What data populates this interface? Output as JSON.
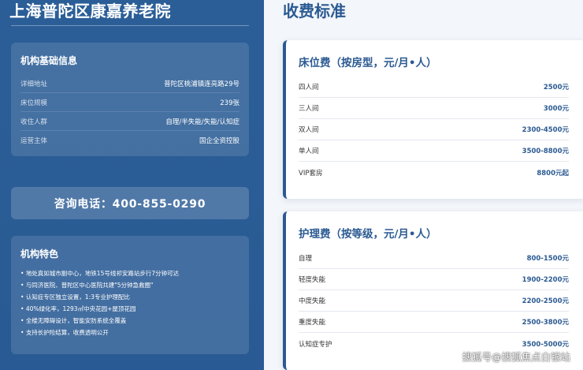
{
  "left": {
    "site_title": "上海普陀区康嘉养老院",
    "info_card": {
      "title": "机构基础信息",
      "rows": [
        {
          "label": "详细地址",
          "value": "普陀区桃浦镇连亮路29号"
        },
        {
          "label": "床位规模",
          "value": "239张"
        },
        {
          "label": "收住人群",
          "value": "自理/半失能/失能/认知症"
        },
        {
          "label": "运营主体",
          "value": "国企全资控股"
        }
      ]
    },
    "phone": "咨询电话：400-855-0290",
    "features_card": {
      "title": "机构特色",
      "items": [
        "地处真如城市副中心，地铁15号线祁安路站步行7分钟可达",
        "与同济医院、普陀区中心医院共建\"5分钟急救圈\"",
        "认知症专区独立设置，1:3专业护理配比",
        "40%绿化率，1293㎡中央花园+屋顶花园",
        "全楼无障碍设计，智能安防系统全覆盖",
        "支持长护险结算，收费透明公开"
      ]
    }
  },
  "right": {
    "title": "收费标准",
    "bed_fee": {
      "title": "床位费（按房型，元/月•人）",
      "rows": [
        {
          "name": "四人间",
          "price": "2500元"
        },
        {
          "name": "三人间",
          "price": "3000元"
        },
        {
          "name": "双人间",
          "price": "2300-4500元"
        },
        {
          "name": "单人间",
          "price": "3500-8800元"
        },
        {
          "name": "VIP套房",
          "price": "8800元起"
        }
      ]
    },
    "care_fee": {
      "title": "护理费（按等级，元/月•人）",
      "rows": [
        {
          "name": "自理",
          "price": "800-1500元"
        },
        {
          "name": "轻度失能",
          "price": "1900-2200元"
        },
        {
          "name": "中度失能",
          "price": "2200-2500元"
        },
        {
          "name": "重度失能",
          "price": "2500-3800元"
        },
        {
          "name": "认知症专护",
          "price": "3500-5000元"
        }
      ]
    }
  },
  "watermark": "搜狐号@搜狐焦点白银站"
}
